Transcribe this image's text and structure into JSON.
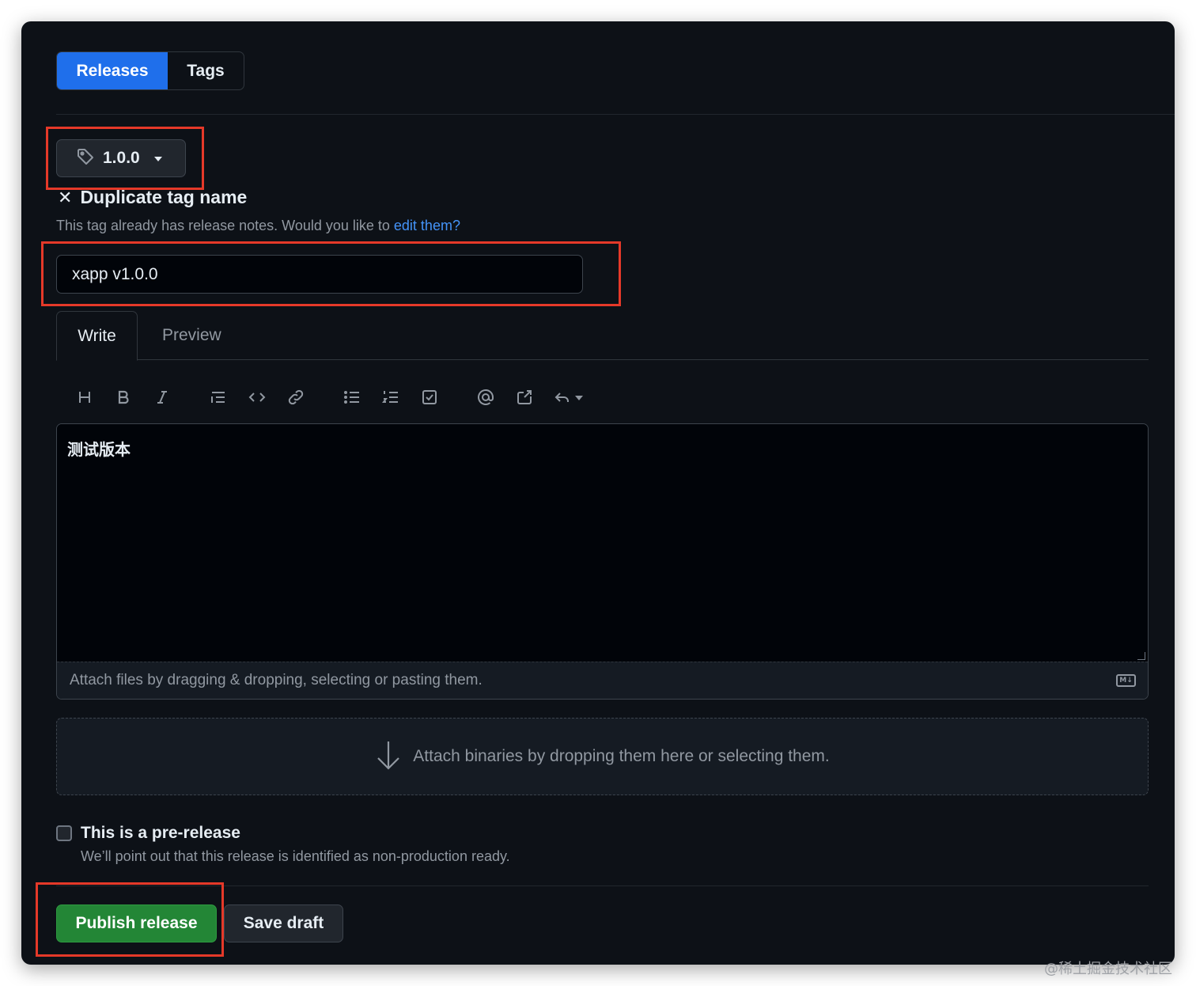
{
  "tabs": {
    "releases": "Releases",
    "tags": "Tags"
  },
  "tag_picker": {
    "value": "1.0.0",
    "icon": "tag-icon"
  },
  "error": {
    "icon": "x-icon",
    "title": "Duplicate tag name",
    "desc_prefix": "This tag already has release notes. Would you like to ",
    "link": "edit them?"
  },
  "release_title": {
    "value": "xapp v1.0.0"
  },
  "editor": {
    "tabs": {
      "write": "Write",
      "preview": "Preview"
    },
    "toolbar": [
      "heading-icon",
      "bold-icon",
      "italic-icon",
      "quote-icon",
      "code-icon",
      "link-icon",
      "unordered-list-icon",
      "ordered-list-icon",
      "task-list-icon",
      "mention-icon",
      "reference-icon",
      "reply-icon"
    ],
    "body": "测试版本",
    "attach_hint": "Attach files by dragging & dropping, selecting or pasting them.",
    "markdown_badge": "M↓"
  },
  "binaries": {
    "text": "Attach binaries by dropping them here or selecting them."
  },
  "prerelease": {
    "label": "This is a pre-release",
    "desc": "We’ll point out that this release is identified as non-production ready.",
    "checked": false
  },
  "actions": {
    "publish": "Publish release",
    "draft": "Save draft"
  },
  "watermark": "@稀土掘金技术社区",
  "colors": {
    "accent": "#1f6feb",
    "publish": "#238636",
    "highlight": "#e53929",
    "bg": "#0d1117"
  }
}
